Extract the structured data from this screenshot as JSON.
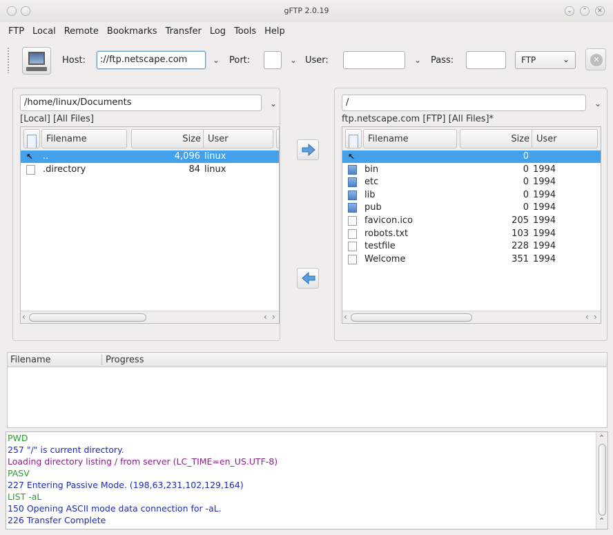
{
  "window": {
    "title": "gFTP 2.0.19"
  },
  "menu": [
    "FTP",
    "Local",
    "Remote",
    "Bookmarks",
    "Transfer",
    "Log",
    "Tools",
    "Help"
  ],
  "toolbar": {
    "host_label": "Host:",
    "host_value": "://ftp.netscape.com",
    "port_label": "Port:",
    "port_value": "",
    "user_label": "User:",
    "user_value": "",
    "pass_label": "Pass:",
    "pass_value": "",
    "protocol": "FTP"
  },
  "local": {
    "path": "/home/linux/Documents",
    "info": "[Local] [All Files]",
    "headers": {
      "filename": "Filename",
      "size": "Size",
      "user": "User"
    },
    "rows": [
      {
        "name": "..",
        "size": "4,096",
        "user": "linux",
        "type": "up",
        "selected": true
      },
      {
        "name": ".directory",
        "size": "84",
        "user": "linux",
        "type": "file",
        "selected": false
      }
    ]
  },
  "remote": {
    "path": "/",
    "info": "ftp.netscape.com [FTP] [All Files]*",
    "headers": {
      "filename": "Filename",
      "size": "Size",
      "user": "User"
    },
    "rows": [
      {
        "name": "",
        "size": "0",
        "user": "",
        "type": "up",
        "selected": true
      },
      {
        "name": "bin",
        "size": "0",
        "user": "1994",
        "type": "folder"
      },
      {
        "name": "etc",
        "size": "0",
        "user": "1994",
        "type": "folder"
      },
      {
        "name": "lib",
        "size": "0",
        "user": "1994",
        "type": "folder"
      },
      {
        "name": "pub",
        "size": "0",
        "user": "1994",
        "type": "folder"
      },
      {
        "name": "favicon.ico",
        "size": "205",
        "user": "1994",
        "type": "file"
      },
      {
        "name": "robots.txt",
        "size": "103",
        "user": "1994",
        "type": "file"
      },
      {
        "name": "testfile",
        "size": "228",
        "user": "1994",
        "type": "file"
      },
      {
        "name": "Welcome",
        "size": "351",
        "user": "1994",
        "type": "file"
      }
    ]
  },
  "queue": {
    "col_filename": "Filename",
    "col_progress": "Progress"
  },
  "log": [
    {
      "text": "PWD",
      "color": "green"
    },
    {
      "text": "257 \"/\" is current directory.",
      "color": "blue"
    },
    {
      "text": "Loading directory listing / from server (LC_TIME=en_US.UTF-8)",
      "color": "purple"
    },
    {
      "text": "PASV",
      "color": "green"
    },
    {
      "text": "227 Entering Passive Mode. (198,63,231,102,129,164)",
      "color": "blue"
    },
    {
      "text": "LIST -aL",
      "color": "green"
    },
    {
      "text": "150 Opening ASCII mode data connection for -aL.",
      "color": "blue"
    },
    {
      "text": "226 Transfer Complete",
      "color": "blue"
    }
  ]
}
